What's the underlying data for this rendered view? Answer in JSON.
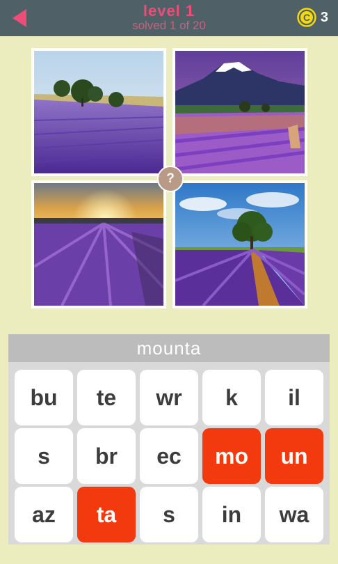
{
  "header": {
    "level_title": "level 1",
    "progress_text": "solved 1 of 20",
    "coin_symbol": "C",
    "coin_count": "3"
  },
  "puzzle": {
    "hint_symbol": "?",
    "current_answer": "mounta",
    "photos": [
      "lavender-field-with-trees",
      "mountain-over-lavender-field",
      "sunset-over-lavender-field",
      "tree-at-end-of-lavender-rows"
    ]
  },
  "tiles": [
    {
      "text": "bu",
      "used": false
    },
    {
      "text": "te",
      "used": false
    },
    {
      "text": "wr",
      "used": false
    },
    {
      "text": "k",
      "used": false
    },
    {
      "text": "il",
      "used": false
    },
    {
      "text": "s",
      "used": false
    },
    {
      "text": "br",
      "used": false
    },
    {
      "text": "ec",
      "used": false
    },
    {
      "text": "mo",
      "used": true
    },
    {
      "text": "un",
      "used": true
    },
    {
      "text": "az",
      "used": false
    },
    {
      "text": "ta",
      "used": true
    },
    {
      "text": "s",
      "used": false
    },
    {
      "text": "in",
      "used": false
    },
    {
      "text": "wa",
      "used": false
    }
  ],
  "colors": {
    "background": "#ecedbf",
    "topbar": "#4f6167",
    "accent_pink": "#ee4d78",
    "tile_used": "#f33a0e",
    "coin_yellow": "#f5d90a"
  },
  "icons": [
    "back-arrow-icon",
    "coin-icon",
    "hint-icon"
  ]
}
